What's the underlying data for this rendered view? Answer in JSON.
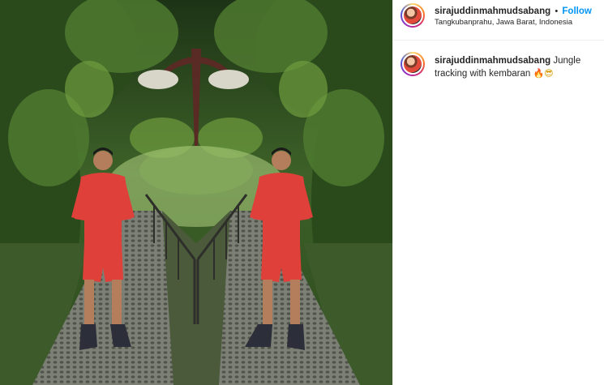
{
  "photo": {
    "alt_subject": "mirrored-man-in-red-tracksuit-on-jungle-path"
  },
  "post": {
    "username": "sirajuddinmahmudsabang",
    "separator": "•",
    "follow_label": "Follow",
    "location": "Tangkubanprahu, Jawa Barat, Indonesia"
  },
  "comment": {
    "username": "sirajuddinmahmudsabang",
    "text": "Jungle tracking with kembaran",
    "emoji_fire": "🔥",
    "emoji_cool": "😎"
  },
  "colors": {
    "follow_blue": "#0095f6",
    "tracksuit_red": "#e0403a"
  }
}
